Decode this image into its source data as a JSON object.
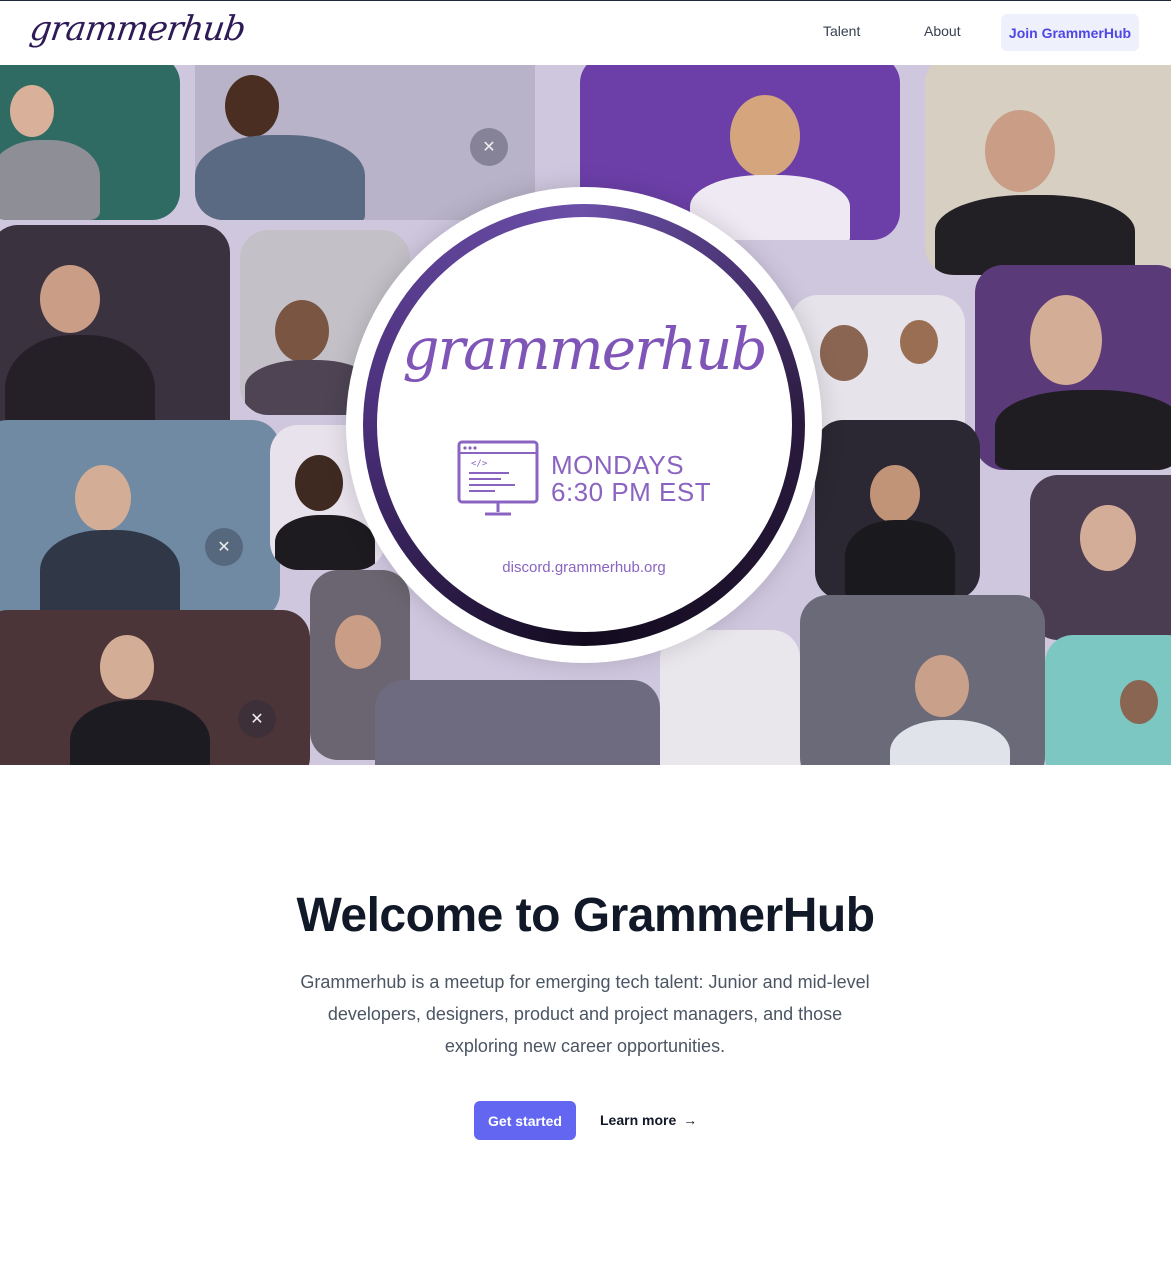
{
  "header": {
    "logo_text": "grammerhub",
    "nav": [
      {
        "label": "Talent"
      },
      {
        "label": "About"
      }
    ],
    "cta_label": "Join GrammerHub"
  },
  "hero": {
    "badge_logo": "grammerhub",
    "schedule_day": "MONDAYS",
    "schedule_time": "6:30 PM EST",
    "url": "discord.grammerhub.org"
  },
  "main": {
    "title": "Welcome to GrammerHub",
    "description": "Grammerhub is a meetup for emerging tech talent: Junior and mid-level developers, designers, product and project managers, and those exploring new career opportunities.",
    "primary_button": "Get started",
    "secondary_link": "Learn more",
    "secondary_arrow": "→"
  },
  "colors": {
    "accent": "#6366f1",
    "brand_purple": "#8055b8",
    "logo_dark": "#2e1a57"
  }
}
